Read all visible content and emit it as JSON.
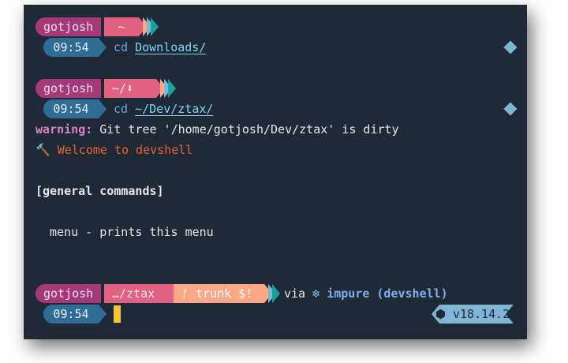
{
  "prompts": [
    {
      "user": "gotjosh",
      "dir": "~",
      "time": "09:54",
      "cmd": "cd",
      "arg": "Downloads/"
    },
    {
      "user": "gotjosh",
      "dir": "~/⬇",
      "time": "09:54",
      "cmd": "cd",
      "arg": "~/Dev/ztax/"
    }
  ],
  "warning": {
    "label": "warning:",
    "text": " Git tree '/home/gotjosh/Dev/ztax' is dirty"
  },
  "welcome": {
    "icon": "🔨",
    "text": "Welcome to devshell"
  },
  "section": "[general commands]",
  "menu_line": "menu - prints this menu",
  "last_prompt": {
    "user": "gotjosh",
    "dir": "…/ztax",
    "git": "ᚠ trunk $!",
    "via": "via",
    "snow": "❄",
    "env": "impure (devshell)",
    "time": "09:54",
    "node": "⬢ v18.14.2"
  },
  "colors": {
    "bg": "#1f2a36",
    "user": "#a4397a",
    "dir": "#e06182",
    "git": "#f9a787",
    "time": "#2f6d96",
    "cursor": "#f6c33a"
  }
}
